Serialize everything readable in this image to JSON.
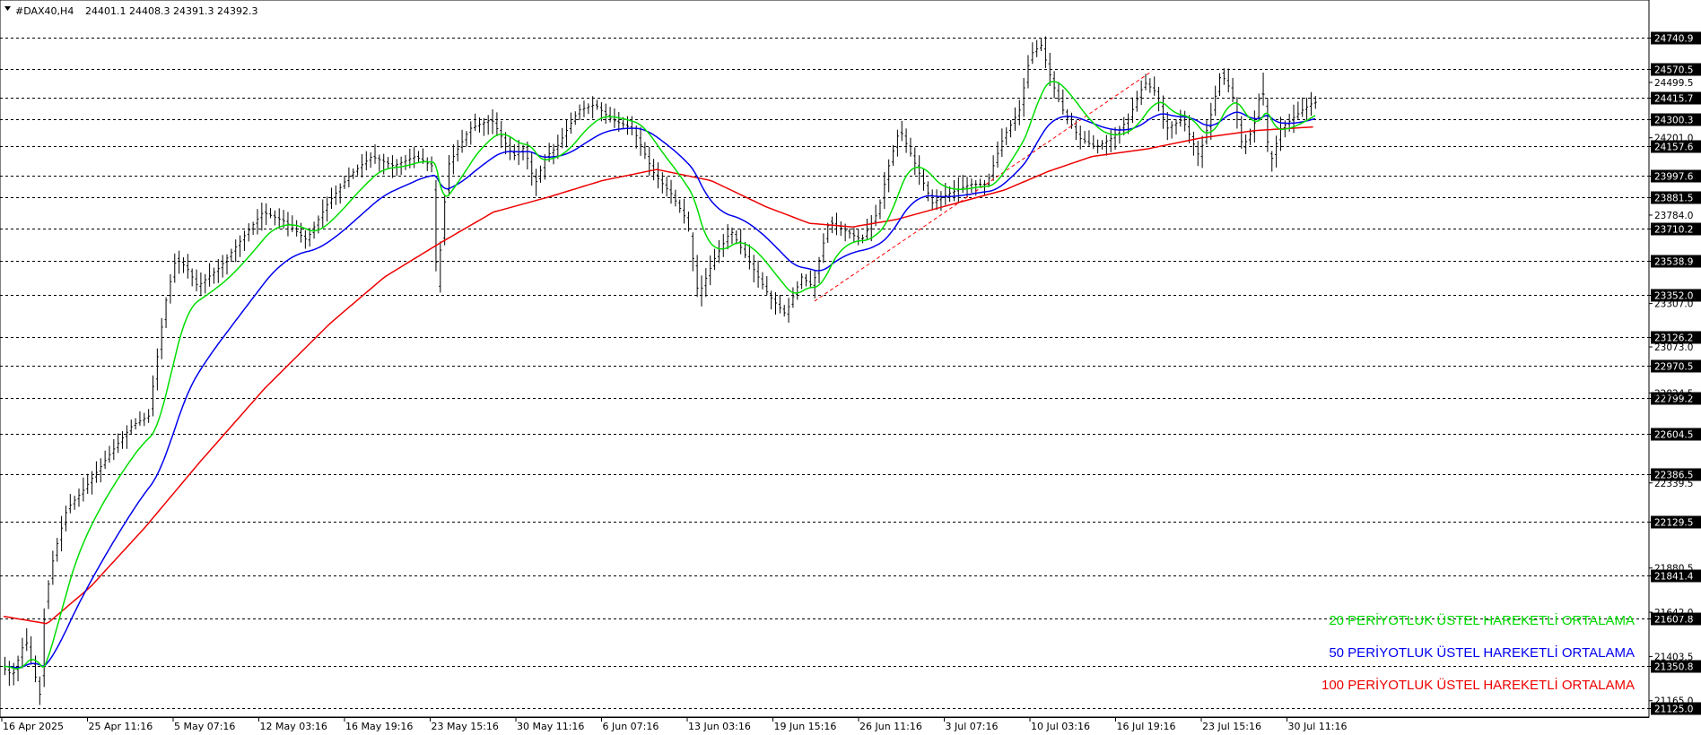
{
  "header": {
    "symbol": "#DAX40,H4",
    "ohlc": "24401.1 24408.3 24391.3 24392.3"
  },
  "chart_data": {
    "type": "line",
    "title": "#DAX40,H4",
    "price_axis": {
      "range": [
        21125.0,
        24800.0
      ],
      "levels": [
        24740.9,
        24570.5,
        24415.7,
        24300.3,
        24157.6,
        23997.6,
        23881.5,
        23710.2,
        23538.9,
        23352.0,
        23126.2,
        22970.5,
        22799.2,
        22604.5,
        22386.5,
        22129.5,
        21841.4,
        21607.8,
        21350.8,
        21125.0
      ],
      "ticks": [
        "24499.5",
        "24201.0",
        "23784.0",
        "23307.0",
        "23073.0",
        "22824.5",
        "22339.5",
        "21880.5",
        "21642.0",
        "21403.5",
        "21165.0"
      ]
    },
    "x_labels": [
      "16 Apr 2025",
      "25 Apr 11:16",
      "5 May 07:16",
      "12 May 03:16",
      "16 May 19:16",
      "23 May 15:16",
      "30 May 11:16",
      "6 Jun 07:16",
      "13 Jun 03:16",
      "19 Jun 15:16",
      "26 Jun 11:16",
      "3 Jul 07:16",
      "10 Jul 03:16",
      "16 Jul 19:16",
      "23 Jul 15:16",
      "30 Jul 11:16"
    ],
    "price_anchors": [
      [
        0,
        21350
      ],
      [
        10,
        21300
      ],
      [
        22,
        21500
      ],
      [
        35,
        21200
      ],
      [
        40,
        21700
      ],
      [
        48,
        21950
      ],
      [
        60,
        22200
      ],
      [
        75,
        22300
      ],
      [
        100,
        22500
      ],
      [
        120,
        22650
      ],
      [
        135,
        22700
      ],
      [
        150,
        23300
      ],
      [
        160,
        23550
      ],
      [
        170,
        23500
      ],
      [
        180,
        23400
      ],
      [
        200,
        23500
      ],
      [
        220,
        23650
      ],
      [
        240,
        23800
      ],
      [
        260,
        23750
      ],
      [
        280,
        23650
      ],
      [
        300,
        23850
      ],
      [
        320,
        24000
      ],
      [
        340,
        24100
      ],
      [
        360,
        24050
      ],
      [
        380,
        24100
      ],
      [
        395,
        24050
      ],
      [
        400,
        23400
      ],
      [
        410,
        24050
      ],
      [
        430,
        24250
      ],
      [
        450,
        24300
      ],
      [
        460,
        24200
      ],
      [
        470,
        24100
      ],
      [
        480,
        24150
      ],
      [
        490,
        23950
      ],
      [
        500,
        24100
      ],
      [
        510,
        24150
      ],
      [
        530,
        24350
      ],
      [
        545,
        24380
      ],
      [
        560,
        24300
      ],
      [
        580,
        24250
      ],
      [
        600,
        24000
      ],
      [
        615,
        23900
      ],
      [
        630,
        23750
      ],
      [
        640,
        23350
      ],
      [
        655,
        23550
      ],
      [
        670,
        23700
      ],
      [
        690,
        23500
      ],
      [
        705,
        23350
      ],
      [
        720,
        23250
      ],
      [
        735,
        23450
      ],
      [
        745,
        23400
      ],
      [
        760,
        23750
      ],
      [
        775,
        23700
      ],
      [
        790,
        23650
      ],
      [
        805,
        23800
      ],
      [
        815,
        24050
      ],
      [
        825,
        24250
      ],
      [
        840,
        24050
      ],
      [
        855,
        23850
      ],
      [
        870,
        23900
      ],
      [
        890,
        23950
      ],
      [
        905,
        23950
      ],
      [
        920,
        24200
      ],
      [
        935,
        24350
      ],
      [
        945,
        24650
      ],
      [
        955,
        24700
      ],
      [
        965,
        24500
      ],
      [
        975,
        24350
      ],
      [
        990,
        24200
      ],
      [
        1005,
        24150
      ],
      [
        1020,
        24200
      ],
      [
        1035,
        24300
      ],
      [
        1050,
        24500
      ],
      [
        1060,
        24450
      ],
      [
        1070,
        24250
      ],
      [
        1085,
        24300
      ],
      [
        1100,
        24100
      ],
      [
        1110,
        24300
      ],
      [
        1120,
        24550
      ],
      [
        1130,
        24450
      ],
      [
        1140,
        24150
      ],
      [
        1150,
        24250
      ],
      [
        1158,
        24500
      ],
      [
        1165,
        24050
      ],
      [
        1175,
        24250
      ],
      [
        1185,
        24300
      ],
      [
        1195,
        24350
      ],
      [
        1205,
        24392
      ]
    ],
    "series": [
      {
        "name": "20 PERİYOTLUK ÜSTEL HAREKETLİ ORTALAMA",
        "color": "#00dd00",
        "period": 20
      },
      {
        "name": "50 PERİYOTLUK ÜSTEL HAREKETLİ ORTALAMA",
        "color": "#0000ee",
        "period": 50
      },
      {
        "name": "100 PERİYOTLUK ÜSTEL HAREKETLİ ORTALAMA",
        "color": "#ee0000",
        "period": 100,
        "anchors": [
          [
            0,
            21620
          ],
          [
            40,
            21580
          ],
          [
            80,
            21780
          ],
          [
            130,
            22100
          ],
          [
            180,
            22450
          ],
          [
            240,
            22850
          ],
          [
            300,
            23200
          ],
          [
            350,
            23450
          ],
          [
            400,
            23630
          ],
          [
            450,
            23800
          ],
          [
            500,
            23880
          ],
          [
            550,
            23970
          ],
          [
            600,
            24030
          ],
          [
            650,
            23970
          ],
          [
            700,
            23830
          ],
          [
            740,
            23740
          ],
          [
            780,
            23720
          ],
          [
            820,
            23760
          ],
          [
            870,
            23840
          ],
          [
            920,
            23920
          ],
          [
            960,
            24020
          ],
          [
            1000,
            24100
          ],
          [
            1050,
            24140
          ],
          [
            1100,
            24200
          ],
          [
            1150,
            24240
          ],
          [
            1205,
            24260
          ]
        ]
      }
    ],
    "trend_line": {
      "color": "#ff0000",
      "style": "dashed",
      "points": [
        [
          745,
          23320
        ],
        [
          1055,
          24560
        ]
      ]
    },
    "last_price": 24392.3,
    "grid": true,
    "legend_position": "bottom-right"
  }
}
